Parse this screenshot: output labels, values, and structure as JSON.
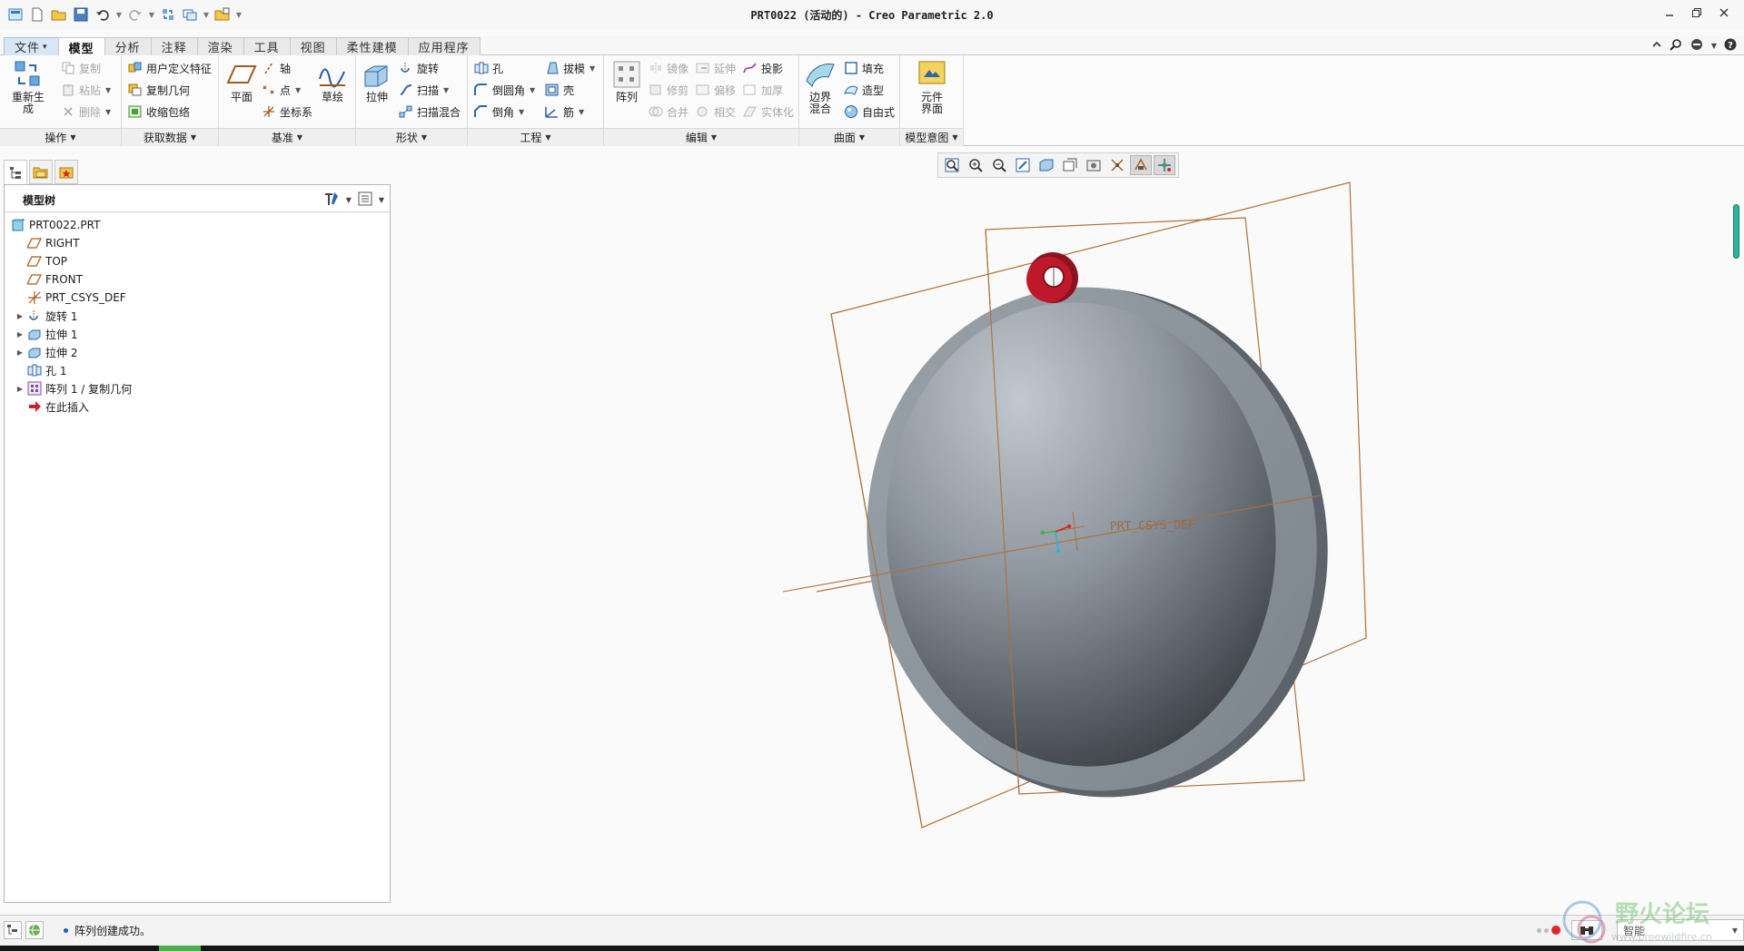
{
  "window": {
    "title": "PRT0022 (活动的) - Creo Parametric 2.0"
  },
  "quick_access": {
    "icons": [
      "app-icon",
      "new-icon",
      "open-icon",
      "save-icon",
      "undo-icon",
      "redo-icon",
      "regenerate-icon",
      "windows-icon",
      "close-window-icon",
      "customize-icon"
    ]
  },
  "tabs": [
    {
      "label": "文件",
      "kind": "file"
    },
    {
      "label": "模型",
      "kind": "active"
    },
    {
      "label": "分析"
    },
    {
      "label": "注释"
    },
    {
      "label": "渲染"
    },
    {
      "label": "工具"
    },
    {
      "label": "视图"
    },
    {
      "label": "柔性建模"
    },
    {
      "label": "应用程序"
    }
  ],
  "ribbon": {
    "operations": {
      "footer": "操作",
      "regenerate": "重新生成",
      "copy": "复制",
      "paste": "粘贴",
      "delete": "删除"
    },
    "get_data": {
      "footer": "获取数据",
      "udf": "用户定义特征",
      "copy_geom": "复制几何",
      "shrinkwrap": "收缩包络"
    },
    "datum": {
      "footer": "基准",
      "plane": "平面",
      "axis": "轴",
      "point": "点",
      "csys": "坐标系",
      "sketch": "草绘"
    },
    "shapes": {
      "footer": "形状",
      "extrude": "拉伸",
      "revolve": "旋转",
      "sweep": "扫描",
      "swept_blend": "扫描混合"
    },
    "engineering": {
      "footer": "工程",
      "hole": "孔",
      "round": "倒圆角",
      "chamfer": "倒角",
      "draft": "拔模",
      "shell": "壳",
      "rib": "筋"
    },
    "editing": {
      "footer": "编辑",
      "pattern": "阵列",
      "mirror": "镜像",
      "trim": "修剪",
      "merge": "合并",
      "extend": "延伸",
      "offset": "偏移",
      "intersect": "相交",
      "project": "投影",
      "thicken": "加厚",
      "solidify": "实体化"
    },
    "surfaces": {
      "footer": "曲面",
      "boundary_blend": "边界\n混合",
      "fill": "填充",
      "style": "造型",
      "freestyle": "自由式"
    },
    "design_intent": {
      "footer": "模型意图",
      "component_interface": "元件\n界面"
    }
  },
  "model_tree": {
    "title": "模型树",
    "items": [
      {
        "label": "PRT0022.PRT",
        "icon": "part-icon",
        "expandable": false,
        "indent": 0
      },
      {
        "label": "RIGHT",
        "icon": "datum-plane-icon",
        "expandable": false,
        "indent": 1
      },
      {
        "label": "TOP",
        "icon": "datum-plane-icon",
        "expandable": false,
        "indent": 1
      },
      {
        "label": "FRONT",
        "icon": "datum-plane-icon",
        "expandable": false,
        "indent": 1
      },
      {
        "label": "PRT_CSYS_DEF",
        "icon": "csys-icon",
        "expandable": false,
        "indent": 1
      },
      {
        "label": "旋转 1",
        "icon": "revolve-icon",
        "expandable": true,
        "indent": 1
      },
      {
        "label": "拉伸 1",
        "icon": "extrude-icon",
        "expandable": true,
        "indent": 1
      },
      {
        "label": "拉伸 2",
        "icon": "extrude-icon",
        "expandable": true,
        "indent": 1
      },
      {
        "label": "孔 1",
        "icon": "hole-icon",
        "expandable": false,
        "indent": 1
      },
      {
        "label": "阵列 1 / 复制几何",
        "icon": "pattern-icon",
        "expandable": true,
        "indent": 1
      },
      {
        "label": "在此插入",
        "icon": "insert-here-icon",
        "expandable": false,
        "indent": 1
      }
    ]
  },
  "viewport": {
    "csys_label": "PRT_CSYS_DEF",
    "colors": {
      "datum": "#b0703a",
      "body": "#8f979f",
      "hook": "#c0182b"
    }
  },
  "status": {
    "message": "阵列创建成功。",
    "filter": "智能"
  },
  "watermark": {
    "text": "野火论坛",
    "url": "www.proewildfire.cn"
  }
}
